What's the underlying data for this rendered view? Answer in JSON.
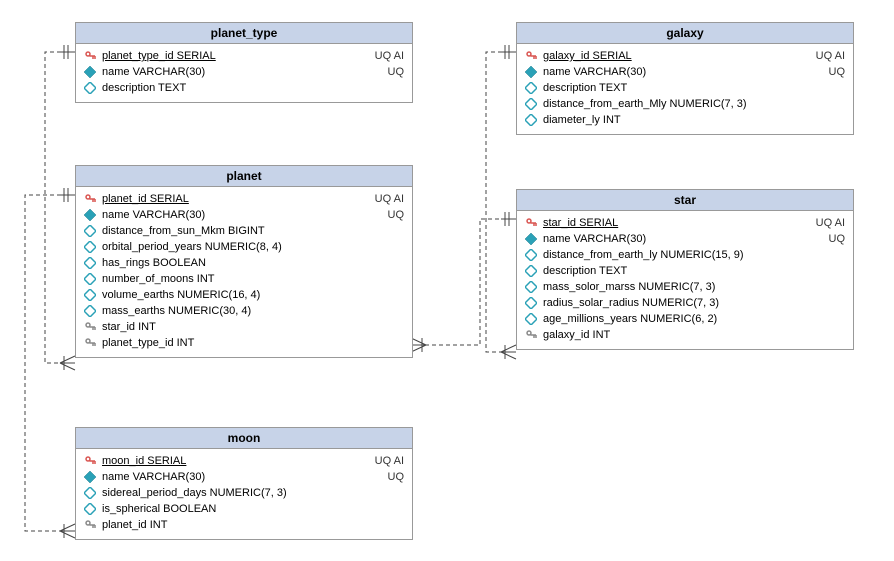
{
  "chart_data": {
    "type": "table",
    "diagram": "entity-relationship",
    "entities": [
      {
        "name": "planet_type",
        "columns": [
          "planet_type_id SERIAL",
          "name VARCHAR(30)",
          "description TEXT"
        ]
      },
      {
        "name": "planet",
        "columns": [
          "planet_id SERIAL",
          "name VARCHAR(30)",
          "distance_from_sun_Mkm BIGINT",
          "orbital_period_years NUMERIC(8, 4)",
          "has_rings BOOLEAN",
          "number_of_moons INT",
          "volume_earths NUMERIC(16, 4)",
          "mass_earths NUMERIC(30, 4)",
          "star_id INT",
          "planet_type_id INT"
        ]
      },
      {
        "name": "moon",
        "columns": [
          "moon_id SERIAL",
          "name VARCHAR(30)",
          "sidereal_period_days NUMERIC(7, 3)",
          "is_spherical BOOLEAN",
          "planet_id INT"
        ]
      },
      {
        "name": "galaxy",
        "columns": [
          "galaxy_id SERIAL",
          "name VARCHAR(30)",
          "description TEXT",
          "distance_from_earth_Mly NUMERIC(7, 3)",
          "diameter_ly INT"
        ]
      },
      {
        "name": "star",
        "columns": [
          "star_id SERIAL",
          "name VARCHAR(30)",
          "distance_from_earth_ly NUMERIC(15, 9)",
          "description TEXT",
          "mass_solor_marss NUMERIC(7, 3)",
          "radius_solar_radius NUMERIC(7, 3)",
          "age_millions_years NUMERIC(6, 2)",
          "galaxy_id INT"
        ]
      }
    ],
    "relationships": [
      {
        "from": "planet.planet_type_id",
        "to": "planet_type.planet_type_id"
      },
      {
        "from": "planet.star_id",
        "to": "star.star_id"
      },
      {
        "from": "moon.planet_id",
        "to": "planet.planet_id"
      },
      {
        "from": "star.galaxy_id",
        "to": "galaxy.galaxy_id"
      }
    ]
  },
  "entities": {
    "planet_type": {
      "title": "planet_type",
      "rows": [
        {
          "icon": "pk",
          "name": "planet_type_id SERIAL",
          "flags": "UQ AI",
          "pk": true
        },
        {
          "icon": "uq",
          "name": "name VARCHAR(30)",
          "flags": "UQ"
        },
        {
          "icon": "col",
          "name": "description TEXT",
          "flags": ""
        }
      ]
    },
    "planet": {
      "title": "planet",
      "rows": [
        {
          "icon": "pk",
          "name": "planet_id SERIAL",
          "flags": "UQ AI",
          "pk": true
        },
        {
          "icon": "uq",
          "name": "name VARCHAR(30)",
          "flags": "UQ"
        },
        {
          "icon": "col",
          "name": "distance_from_sun_Mkm BIGINT",
          "flags": ""
        },
        {
          "icon": "col",
          "name": "orbital_period_years NUMERIC(8, 4)",
          "flags": ""
        },
        {
          "icon": "col",
          "name": "has_rings BOOLEAN",
          "flags": ""
        },
        {
          "icon": "col",
          "name": "number_of_moons INT",
          "flags": ""
        },
        {
          "icon": "col",
          "name": "volume_earths NUMERIC(16, 4)",
          "flags": ""
        },
        {
          "icon": "col",
          "name": "mass_earths NUMERIC(30, 4)",
          "flags": ""
        },
        {
          "icon": "fk",
          "name": "star_id INT",
          "flags": ""
        },
        {
          "icon": "fk",
          "name": "planet_type_id INT",
          "flags": ""
        }
      ]
    },
    "moon": {
      "title": "moon",
      "rows": [
        {
          "icon": "pk",
          "name": "moon_id SERIAL",
          "flags": "UQ AI",
          "pk": true
        },
        {
          "icon": "uq",
          "name": "name VARCHAR(30)",
          "flags": "UQ"
        },
        {
          "icon": "col",
          "name": "sidereal_period_days NUMERIC(7, 3)",
          "flags": ""
        },
        {
          "icon": "col",
          "name": "is_spherical BOOLEAN",
          "flags": ""
        },
        {
          "icon": "fk",
          "name": "planet_id INT",
          "flags": ""
        }
      ]
    },
    "galaxy": {
      "title": "galaxy",
      "rows": [
        {
          "icon": "pk",
          "name": "galaxy_id SERIAL",
          "flags": "UQ AI",
          "pk": true
        },
        {
          "icon": "uq",
          "name": "name VARCHAR(30)",
          "flags": "UQ"
        },
        {
          "icon": "col",
          "name": "description TEXT",
          "flags": ""
        },
        {
          "icon": "col",
          "name": "distance_from_earth_Mly NUMERIC(7, 3)",
          "flags": ""
        },
        {
          "icon": "col",
          "name": "diameter_ly INT",
          "flags": ""
        }
      ]
    },
    "star": {
      "title": "star",
      "rows": [
        {
          "icon": "pk",
          "name": "star_id SERIAL",
          "flags": "UQ AI",
          "pk": true
        },
        {
          "icon": "uq",
          "name": "name VARCHAR(30)",
          "flags": "UQ"
        },
        {
          "icon": "col",
          "name": "distance_from_earth_ly NUMERIC(15, 9)",
          "flags": ""
        },
        {
          "icon": "col",
          "name": "description TEXT",
          "flags": ""
        },
        {
          "icon": "col",
          "name": "mass_solor_marss NUMERIC(7, 3)",
          "flags": ""
        },
        {
          "icon": "col",
          "name": "radius_solar_radius NUMERIC(7, 3)",
          "flags": ""
        },
        {
          "icon": "col",
          "name": "age_millions_years NUMERIC(6, 2)",
          "flags": ""
        },
        {
          "icon": "fk",
          "name": "galaxy_id INT",
          "flags": ""
        }
      ]
    }
  }
}
